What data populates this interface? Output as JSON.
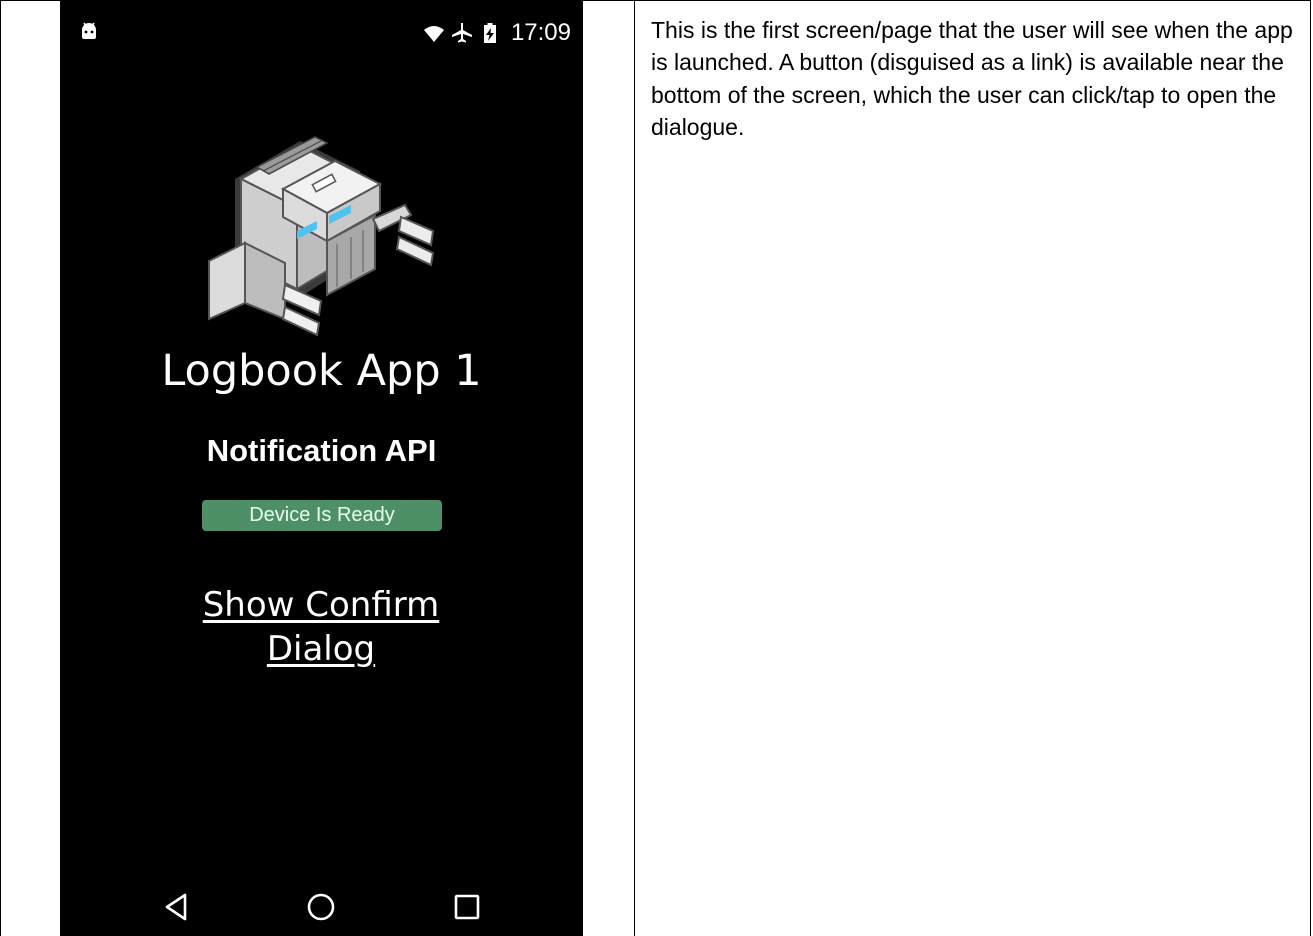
{
  "phone": {
    "status_bar": {
      "time": "17:09",
      "icons": [
        "android-debug-icon",
        "wifi-icon",
        "airplane-icon",
        "battery-charging-icon"
      ]
    },
    "app": {
      "title": "Logbook App 1",
      "subtitle": "Notification API",
      "device_status": "Device Is Ready",
      "device_status_color": "#4d8f66",
      "confirm_link": "Show Confirm Dialog"
    },
    "nav_bar": {
      "icons": [
        "back-icon",
        "home-icon",
        "recents-icon"
      ]
    }
  },
  "description": {
    "text": "This is the first screen/page that the user will see when the app is launched. A button (disguised as a link) is available near the bottom of the screen, which the user can click/tap to open the dialogue."
  }
}
